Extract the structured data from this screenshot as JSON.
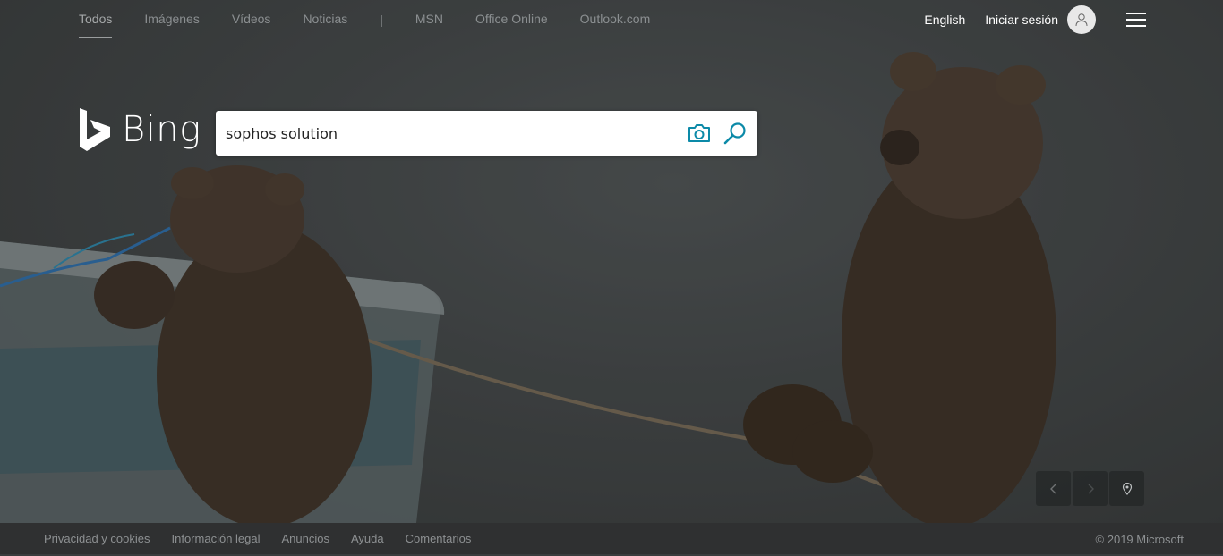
{
  "nav": {
    "items": [
      {
        "label": "Todos",
        "active": true
      },
      {
        "label": "Imágenes"
      },
      {
        "label": "Vídeos"
      },
      {
        "label": "Noticias"
      },
      {
        "label": "|"
      },
      {
        "label": "MSN"
      },
      {
        "label": "Office Online"
      },
      {
        "label": "Outlook.com"
      }
    ]
  },
  "header": {
    "language": "English",
    "signin": "Iniciar sesión"
  },
  "logo": {
    "text": "Bing"
  },
  "search": {
    "value": "sophos solution"
  },
  "footer": {
    "links": [
      "Privacidad y cookies",
      "Información legal",
      "Anuncios",
      "Ayuda",
      "Comentarios"
    ],
    "copyright": "© 2019 Microsoft"
  },
  "icons": {
    "camera": "camera-icon",
    "search": "search-icon",
    "prev": "chevron-left-icon",
    "next": "chevron-right-icon",
    "location": "location-pin-icon"
  },
  "colors": {
    "accent": "#0c8aa8",
    "background": "#3a3d3e",
    "footer": "#2f3031"
  }
}
